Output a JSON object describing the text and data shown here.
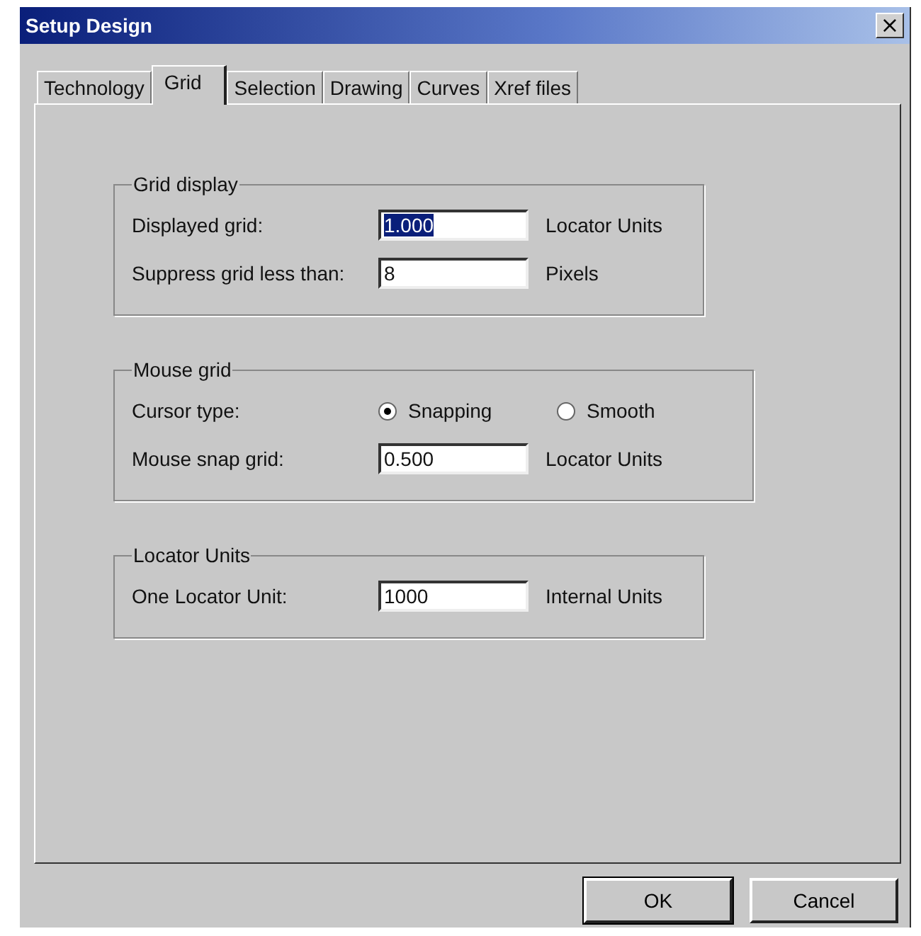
{
  "window": {
    "title": "Setup Design",
    "close": "×"
  },
  "tabs": [
    {
      "label": "Technology",
      "selected": false
    },
    {
      "label": "Grid",
      "selected": true
    },
    {
      "label": "Selection",
      "selected": false
    },
    {
      "label": "Drawing",
      "selected": false
    },
    {
      "label": "Curves",
      "selected": false
    },
    {
      "label": "Xref files",
      "selected": false
    }
  ],
  "groups": [
    {
      "title": "Grid display",
      "rows": [
        {
          "kind": "field",
          "label": "Displayed grid:",
          "value": "1.000",
          "highlighted": true,
          "unit": "Locator Units"
        },
        {
          "kind": "field",
          "label": "Suppress grid less than:",
          "value": "8",
          "highlighted": false,
          "unit": "Pixels"
        }
      ]
    },
    {
      "title": "Mouse grid",
      "rows": [
        {
          "kind": "radio",
          "label": "Cursor type:",
          "options": [
            {
              "label": "Snapping",
              "selected": true
            },
            {
              "label": "Smooth",
              "selected": false
            }
          ]
        },
        {
          "kind": "field",
          "label": "Mouse snap grid:",
          "value": "0.500",
          "highlighted": false,
          "unit": "Locator Units"
        }
      ]
    },
    {
      "title": "Locator Units",
      "rows": [
        {
          "kind": "field",
          "label": "One Locator Unit:",
          "value": "1000",
          "highlighted": false,
          "unit": "Internal Units"
        }
      ]
    }
  ],
  "buttons": [
    "OK",
    "Cancel"
  ]
}
